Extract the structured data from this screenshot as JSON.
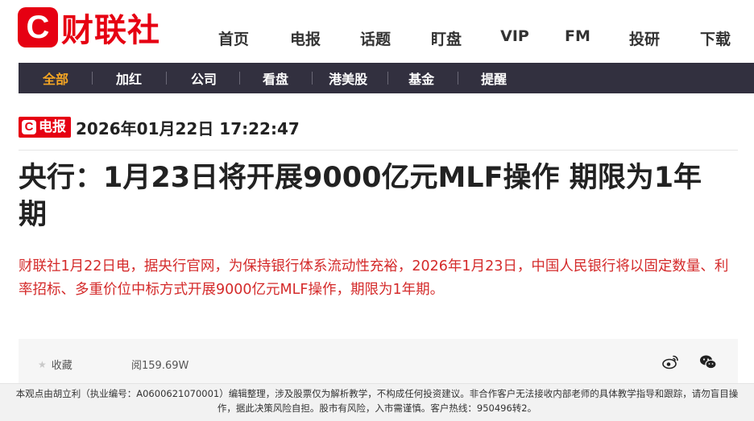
{
  "logo": {
    "badge": "C",
    "text": "财联社"
  },
  "main_nav": [
    "首页",
    "电报",
    "话题",
    "盯盘",
    "VIP",
    "FM",
    "投研",
    "下载"
  ],
  "sub_nav": {
    "items": [
      "全部",
      "加红",
      "公司",
      "看盘",
      "港美股",
      "基金",
      "提醒"
    ],
    "active": "全部"
  },
  "article": {
    "tag": {
      "mark": "C",
      "label": "电报"
    },
    "datetime": "2026年01月22日 17:22:47",
    "headline": "央行：1月23日将开展9000亿元MLF操作 期限为1年期",
    "summary": "财联社1月22日电，据央行官网，为保持银行体系流动性充裕，2026年1月23日，中国人民银行将以固定数量、利率招标、多重价位中标方式开展9000亿元MLF操作，期限为1年期。"
  },
  "actions": {
    "favorite_icon": "star-icon",
    "favorite_label": "收藏",
    "reads": "阅159.69W",
    "share_icons": [
      "weibo-icon",
      "wechat-icon"
    ]
  },
  "disclaimer": "本观点由胡立利（执业编号：A0600621070001）编辑整理，涉及股票仅为解析教学，不构成任何投资建议。非合作客户无法接收内部老师的具体教学指导和跟踪，请勿盲目操作，据此决策风险自担。股市有风险，入市需谨慎。客户热线：950496转2。",
  "colors": {
    "brand_red": "#e60012",
    "summary_red": "#d42a2a",
    "subnav_bg": "#32303f",
    "subnav_active": "#f5a623"
  }
}
